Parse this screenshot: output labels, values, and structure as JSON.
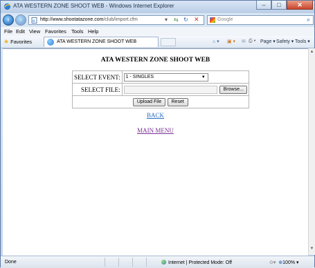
{
  "window": {
    "title": "ATA WESTERN ZONE SHOOT WEB - Windows Internet Explorer",
    "address_host": "http://www.shootatazone.com",
    "address_path": "/club/import.cfm",
    "search_placeholder": "Google",
    "controls": {
      "minimize": "–",
      "maximize": "□",
      "close": "✕"
    }
  },
  "menubar": {
    "items": [
      "File",
      "Edit",
      "View",
      "Favorites",
      "Tools",
      "Help"
    ]
  },
  "favorites_bar": {
    "favorites_label": "Favorites",
    "tab_title": "ATA WESTERN ZONE SHOOT WEB",
    "commands": [
      "Page ▾",
      "Safety ▾",
      "Tools ▾"
    ]
  },
  "page": {
    "heading": "ATA WESTERN ZONE SHOOT WEB",
    "select_event_label": "SELECT EVENT:",
    "select_event_value": "1 - SINGLES",
    "select_file_label": "SELECT FILE:",
    "browse_label": "Browse...",
    "upload_label": "Upload File",
    "reset_label": "Reset",
    "back_link": "BACK",
    "main_menu_link": "MAIN MENU"
  },
  "statusbar": {
    "left": "Done",
    "zone": "Internet | Protected Mode: Off",
    "zoom": "100%"
  },
  "colors": {
    "link_back": "#2a6fc4",
    "link_visited": "#7a2e94",
    "close_button": "#c9462c"
  }
}
